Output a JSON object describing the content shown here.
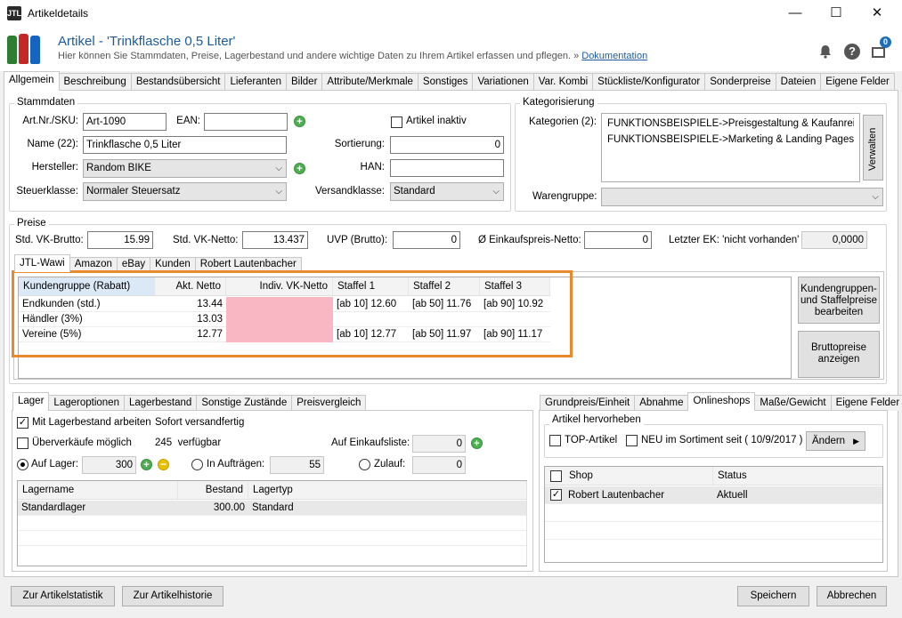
{
  "window": {
    "title": "Artikeldetails",
    "app_icon": "JTL",
    "minimize": "—",
    "maximize": "☐",
    "close": "✕"
  },
  "header": {
    "title": "Artikel - 'Trinkflasche 0,5 Liter'",
    "subtitle": "Hier können Sie Stammdaten, Preise, Lagerbestand und andere wichtige Daten zu Ihrem Artikel erfassen und pflegen. »",
    "doc_link": "Dokumentation",
    "badge": "0"
  },
  "tabs": [
    "Allgemein",
    "Beschreibung",
    "Bestandsübersicht",
    "Lieferanten",
    "Bilder",
    "Attribute/Merkmale",
    "Sonstiges",
    "Variationen",
    "Var. Kombi",
    "Stückliste/Konfigurator",
    "Sonderpreise",
    "Dateien",
    "Eigene Felder"
  ],
  "stammdaten": {
    "legend": "Stammdaten",
    "artnr_label": "Art.Nr./SKU:",
    "artnr": "Art-1090",
    "ean_label": "EAN:",
    "ean": "",
    "inaktiv_label": "Artikel inaktiv",
    "name_label": "Name (22):",
    "name": "Trinkflasche 0,5 Liter",
    "sortierung_label": "Sortierung:",
    "sortierung": "0",
    "hersteller_label": "Hersteller:",
    "hersteller": "Random BIKE",
    "han_label": "HAN:",
    "han": "",
    "steuer_label": "Steuerklasse:",
    "steuer": "Normaler Steuersatz",
    "versand_label": "Versandklasse:",
    "versand": "Standard"
  },
  "kategorisierung": {
    "legend": "Kategorisierung",
    "kat_label": "Kategorien (2):",
    "kategorien": [
      "FUNKTIONSBEISPIELE->Preisgestaltung & Kaufanreize-...",
      "FUNKTIONSBEISPIELE->Marketing & Landing Pages->S..."
    ],
    "verwalten": "Verwalten",
    "warengruppe_label": "Warengruppe:",
    "warengruppe": ""
  },
  "preise": {
    "legend": "Preise",
    "vk_brutto_label": "Std. VK-Brutto:",
    "vk_brutto": "15.99",
    "vk_netto_label": "Std. VK-Netto:",
    "vk_netto": "13.437",
    "uvp_label": "UVP (Brutto):",
    "uvp": "0",
    "ek_label": "Ø Einkaufspreis-Netto:",
    "ek": "0",
    "letzter_ek_label": "Letzter EK: 'nicht vorhanden'",
    "letzter_ek": "0,0000"
  },
  "price_tabs": [
    "JTL-Wawi",
    "Amazon",
    "eBay",
    "Kunden",
    "Robert Lautenbacher"
  ],
  "price_grid": {
    "headers": [
      "Kundengruppe (Rabatt)",
      "Akt. Netto",
      "Indiv. VK-Netto",
      "Staffel 1",
      "Staffel 2",
      "Staffel 3"
    ],
    "rows": [
      {
        "group": "Endkunden (std.)",
        "netto": "13.44",
        "indiv": "",
        "s1": "[ab 10] 12.60",
        "s2": "[ab 50] 11.76",
        "s3": "[ab 90] 10.92"
      },
      {
        "group": "Händler (3%)",
        "netto": "13.03",
        "indiv": "",
        "s1": "",
        "s2": "",
        "s3": ""
      },
      {
        "group": "Vereine (5%)",
        "netto": "12.77",
        "indiv": "",
        "s1": "[ab 10] 12.77",
        "s2": "[ab 50] 11.97",
        "s3": "[ab 90] 11.17"
      }
    ]
  },
  "price_buttons": {
    "kundengruppen": "Kundengruppen- und Staffelpreise bearbeiten",
    "brutto": "Bruttopreise anzeigen"
  },
  "lager_tabs": [
    "Lager",
    "Lageroptionen",
    "Lagerbestand",
    "Sonstige Zustände",
    "Preisvergleich"
  ],
  "lager": {
    "mit_lager": "Mit Lagerbestand arbeiten",
    "sofort": "Sofort versandfertig",
    "ueberverkauf": "Überverkäufe möglich",
    "verfuegbar": "245  verfügbar",
    "einkaufsliste_label": "Auf Einkaufsliste:",
    "einkaufsliste": "0",
    "auf_lager_label": "Auf Lager:",
    "auf_lager": "300",
    "in_auftraegen_label": "In Aufträgen:",
    "in_auftraegen": "55",
    "zulauf_label": "Zulauf:",
    "zulauf": "0",
    "grid_headers": [
      "Lagername",
      "Bestand",
      "Lagertyp"
    ],
    "rows": [
      {
        "name": "Standardlager",
        "bestand": "300.00",
        "typ": "Standard"
      }
    ]
  },
  "right_tabs": [
    "Grundpreis/Einheit",
    "Abnahme",
    "Onlineshops",
    "Maße/Gewicht",
    "Eigene Felder"
  ],
  "onlineshops": {
    "hervorheben_legend": "Artikel hervorheben",
    "top": "TOP-Artikel",
    "neu": "NEU im Sortiment seit ( 10/9/2017 )",
    "aendern": "Ändern",
    "grid_headers": [
      "Shop",
      "Status"
    ],
    "rows": [
      {
        "shop": "Robert Lautenbacher",
        "status": "Aktuell"
      }
    ]
  },
  "footer": {
    "statistik": "Zur Artikelstatistik",
    "historie": "Zur Artikelhistorie",
    "speichern": "Speichern",
    "abbrechen": "Abbrechen"
  },
  "colors": {
    "highlight_border": "#e8892c",
    "indiv_cell": "#f9b7c3",
    "title_blue": "#1d5b9a"
  }
}
